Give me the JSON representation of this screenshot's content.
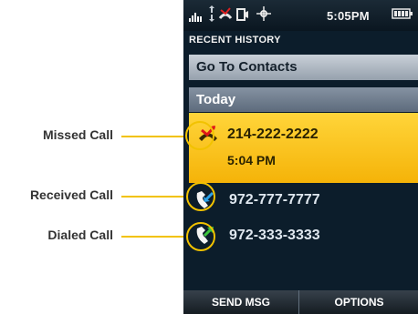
{
  "status_bar": {
    "time": "5:05PM",
    "signal_icon": "signal-bars-icon",
    "data_icon": "data-arrows-icon",
    "missed_icon": "missed-call-notice-icon",
    "voicemail_icon": "voicemail-icon",
    "location_icon": "location-icon",
    "battery_icon": "battery-icon"
  },
  "screen_title": "RECENT HISTORY",
  "go_to_contacts": "Go To Contacts",
  "group_header": "Today",
  "calls": [
    {
      "type": "missed",
      "number": "214-222-2222",
      "time": "5:04 PM",
      "icon": "missed-call-icon",
      "selected": true
    },
    {
      "type": "received",
      "number": "972-777-7777",
      "icon": "received-call-icon",
      "selected": false
    },
    {
      "type": "dialed",
      "number": "972-333-3333",
      "icon": "dialed-call-icon",
      "selected": false
    }
  ],
  "softkeys": {
    "left": "SEND MSG",
    "right": "OPTIONS"
  },
  "callouts": {
    "missed": "Missed Call",
    "received": "Received Call",
    "dialed": "Dialed Call"
  },
  "colors": {
    "highlight": "#f5b308",
    "callout_line": "#f2c200",
    "screen_bg": "#0c1d2b"
  }
}
